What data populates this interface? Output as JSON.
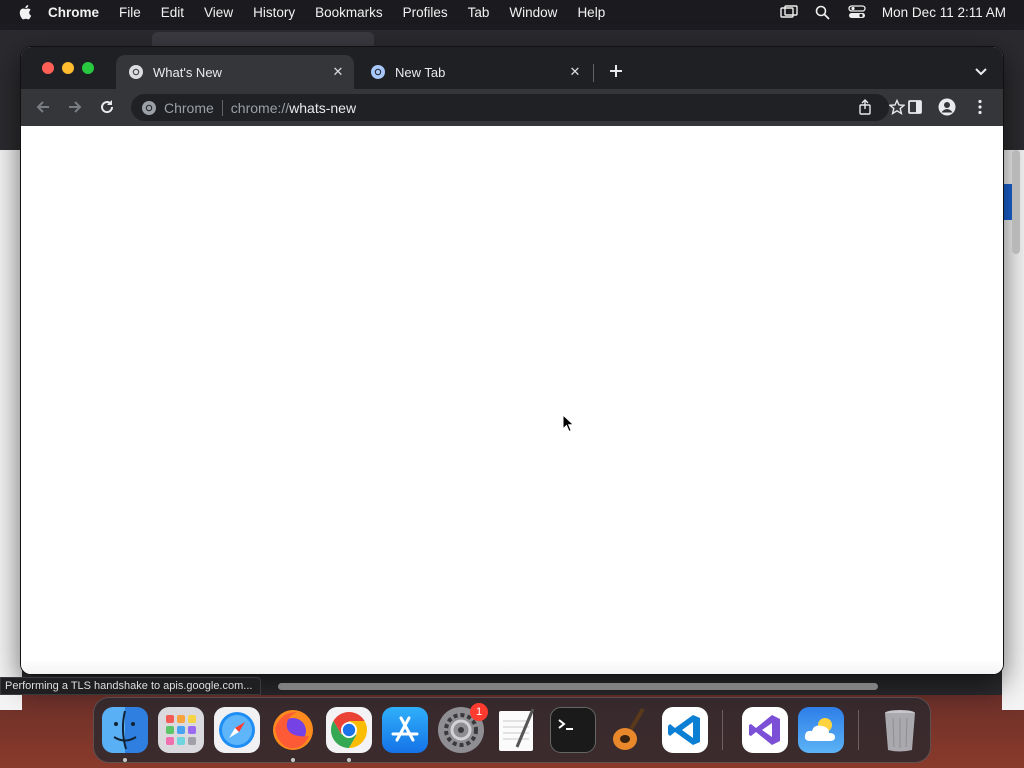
{
  "menubar": {
    "app_name": "Chrome",
    "items": [
      "File",
      "Edit",
      "View",
      "History",
      "Bookmarks",
      "Profiles",
      "Tab",
      "Window",
      "Help"
    ],
    "clock": "Mon Dec 11  2:11 AM"
  },
  "browser": {
    "tabs": [
      {
        "title": "What's New",
        "active": true
      },
      {
        "title": "New Tab",
        "active": false
      }
    ],
    "omnibox": {
      "chip": "Chrome",
      "url_scheme": "chrome://",
      "url_host": "whats-new"
    },
    "status_text": "Performing a TLS handshake to apis.google.com..."
  },
  "dock": {
    "apps": [
      {
        "name": "Finder",
        "icon": "finder-icon",
        "running": true
      },
      {
        "name": "Launchpad",
        "icon": "launchpad-icon",
        "running": false
      },
      {
        "name": "Safari",
        "icon": "safari-icon",
        "running": false
      },
      {
        "name": "Firefox",
        "icon": "firefox-icon",
        "running": true
      },
      {
        "name": "Google Chrome",
        "icon": "chrome-icon",
        "running": true
      },
      {
        "name": "App Store",
        "icon": "app-store-icon",
        "running": false
      },
      {
        "name": "System Settings",
        "icon": "system-settings-icon",
        "running": false,
        "badge": "1"
      },
      {
        "name": "TextEdit",
        "icon": "textedit-icon",
        "running": false
      },
      {
        "name": "Terminal",
        "icon": "terminal-icon",
        "running": false
      },
      {
        "name": "GarageBand",
        "icon": "garageband-icon",
        "running": false
      },
      {
        "name": "Visual Studio Code",
        "icon": "vscode-icon",
        "running": false
      },
      {
        "name": "Visual Studio",
        "icon": "visual-studio-icon",
        "running": false
      },
      {
        "name": "Weather",
        "icon": "weather-icon",
        "running": false
      },
      {
        "name": "Trash",
        "icon": "trash-icon",
        "running": false
      }
    ]
  },
  "colors": {
    "tab_strip": "#1f2023",
    "toolbar": "#35363a",
    "omnibox": "#202124",
    "close_red": "#ff5f57",
    "minimize_yellow": "#febc2e",
    "zoom_green": "#28c840"
  }
}
